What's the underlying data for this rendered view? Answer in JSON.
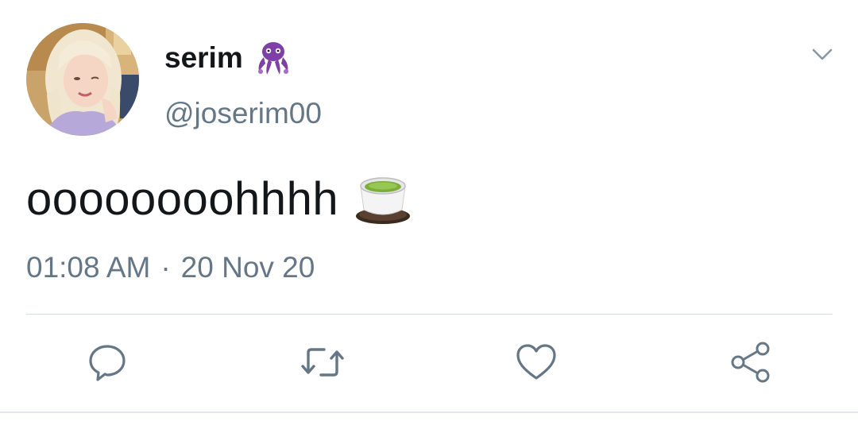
{
  "user": {
    "display_name": "serim",
    "name_emoji": "octopus-emoji",
    "handle": "@joserim00"
  },
  "tweet": {
    "text": "oooooooohhhh",
    "emoji": "green-tea-emoji",
    "time": "01:08 AM",
    "separator": "·",
    "date": "20 Nov 20"
  },
  "actions": [
    {
      "icon": "reply-icon"
    },
    {
      "icon": "retweet-icon"
    },
    {
      "icon": "like-icon"
    },
    {
      "icon": "share-icon"
    }
  ],
  "colors": {
    "text_primary": "#14171a",
    "text_secondary": "#657786",
    "icon": "#657786",
    "divider": "#e1e8ed",
    "emoji_purple": "#8e44ad"
  }
}
